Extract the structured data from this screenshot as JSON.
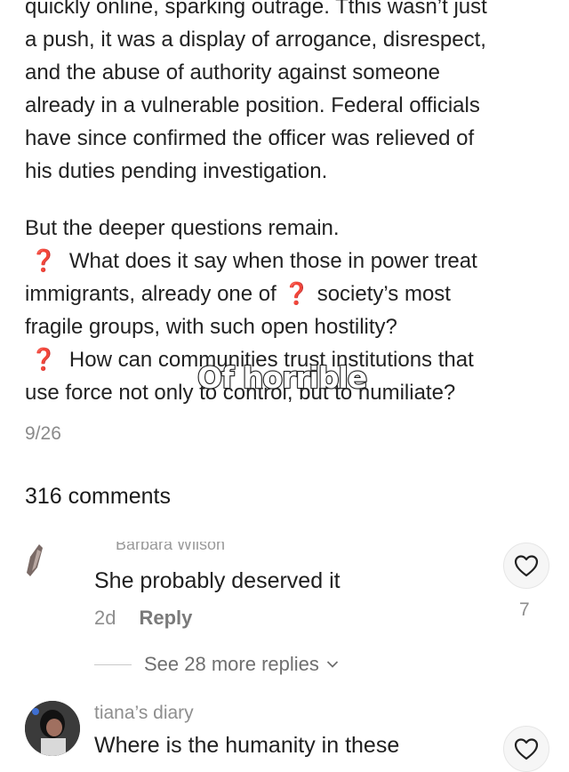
{
  "post": {
    "paragraph1": [
      "quickly online, sparking outrage. Tthis wasn’t just",
      "a push, it was a display of arrogance, disrespect,",
      "and the abuse of authority against someone",
      "already in a vulnerable position. Federal officials",
      "have since confirmed the officer was relieved of",
      "his duties pending investigation."
    ],
    "paragraph2_intro": "But the deeper questions remain.",
    "question_icon": "❓",
    "q1_line1": "What does it say when those in power treat",
    "q1_line2_a": "immigrants, already one of",
    "q1_line2_b": "society’s most",
    "q1_line3": "fragile groups, with such open hostility?",
    "q2_line1": "How can communities trust institutions that",
    "q2_line2": "use force not only to control, but to humiliate?",
    "overlay_caption": "Of horrible",
    "page_indicator": "9/26"
  },
  "comments_header": "316 comments",
  "comments": [
    {
      "username": "Barbara Wilson",
      "text": "She probably deserved it",
      "time": "2d",
      "reply_label": "Reply",
      "likes": "7",
      "more_replies_label": "See 28 more replies"
    },
    {
      "username": "tiana’s diary",
      "text": "Where is the humanity in these"
    }
  ],
  "icons": {
    "heart": "heart-outline-icon",
    "chevron": "chevron-down-icon",
    "question": "red-question-mark-icon"
  },
  "colors": {
    "question_red": "#d93a2b",
    "meta_gray": "#8e8e8e"
  }
}
